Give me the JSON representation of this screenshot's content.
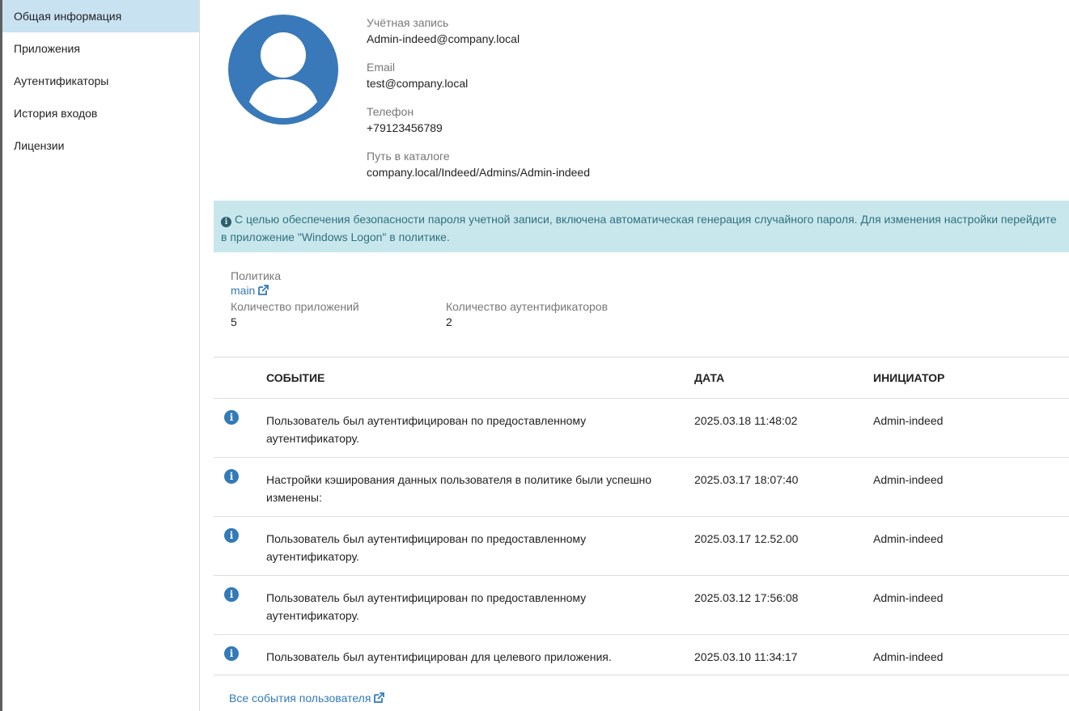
{
  "sidebar": {
    "items": [
      {
        "label": "Общая информация"
      },
      {
        "label": "Приложения"
      },
      {
        "label": "Аутентификаторы"
      },
      {
        "label": "История входов"
      },
      {
        "label": "Лицензии"
      }
    ]
  },
  "profile": {
    "account_label": "Учётная запись",
    "account_value": "Admin-indeed@company.local",
    "email_label": "Email",
    "email_value": "test@company.local",
    "phone_label": "Телефон",
    "phone_value": "+79123456789",
    "path_label": "Путь в каталоге",
    "path_value": "company.local/Indeed/Admins/Admin-indeed"
  },
  "alert": {
    "icon": "info-circle-icon",
    "text": "С целью обеспечения безопасности пароля учетной записи, включена автоматическая генерация случайного пароля. Для изменения настройки перейдите в приложение \"Windows Logon\" в политике."
  },
  "stats": {
    "policy_label": "Политика",
    "policy_link": "main",
    "apps_label": "Количество приложений",
    "apps_value": "5",
    "auth_label": "Количество аутентификаторов",
    "auth_value": "2"
  },
  "events": {
    "headers": {
      "event": "СОБЫТИЕ",
      "date": "ДАТА",
      "initiator": "ИНИЦИАТОР"
    },
    "rows": [
      {
        "text": "Пользователь был аутентифицирован по предоставленному аутентификатору.",
        "date": "2025.03.18 11:48:02",
        "initiator": "Admin-indeed"
      },
      {
        "text": "Настройки кэширования данных пользователя в политике были успешно изменены:",
        "date": "2025.03.17 18:07:40",
        "initiator": "Admin-indeed"
      },
      {
        "text": "Пользователь был аутентифицирован по предоставленному аутентификатору.",
        "date": "2025.03.17 12.52.00",
        "initiator": "Admin-indeed"
      },
      {
        "text": "Пользователь был аутентифицирован по предоставленному аутентификатору.",
        "date": "2025.03.12 17:56:08",
        "initiator": "Admin-indeed"
      },
      {
        "text": "Пользователь был аутентифицирован для целевого приложения.",
        "date": "2025.03.10 11:34:17",
        "initiator": "Admin-indeed"
      }
    ],
    "all_link": "Все события пользователя"
  },
  "colors": {
    "accent": "#337ab7",
    "nav_active": "#c9e2f2",
    "alert_bg": "#c8e7ec",
    "alert_text": "#31707f",
    "avatar": "#3979b9"
  }
}
